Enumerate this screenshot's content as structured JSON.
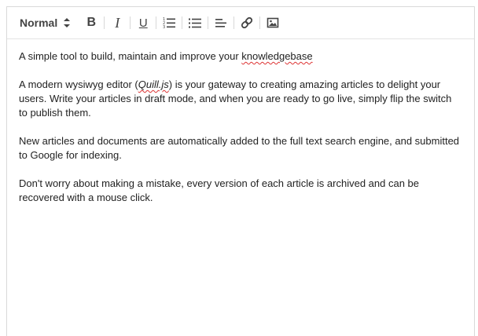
{
  "toolbar": {
    "format_value": "Normal",
    "bold_label": "B",
    "italic_label": "I",
    "underline_label": "U"
  },
  "content": {
    "p1": {
      "before": "A simple tool to build, maintain and improve your ",
      "misspelled": "knowledgebase"
    },
    "p2": {
      "before": "A modern wysiwyg editor (",
      "link": "Quill.js",
      "after": ") is your gateway to creating amazing articles to delight your users. Write your articles in draft mode, and when you are ready to go live, simply flip the switch to publish them."
    },
    "p3": "New articles and documents are automatically added to the full text search engine, and submitted to Google for indexing.",
    "p4": "Don't worry about making a mistake, every version of each article is archived and can be recovered with a mouse click."
  },
  "colors": {
    "border": "#d9d9d9",
    "text": "#222222",
    "icon": "#444444",
    "spellcheck": "#dd3333"
  }
}
